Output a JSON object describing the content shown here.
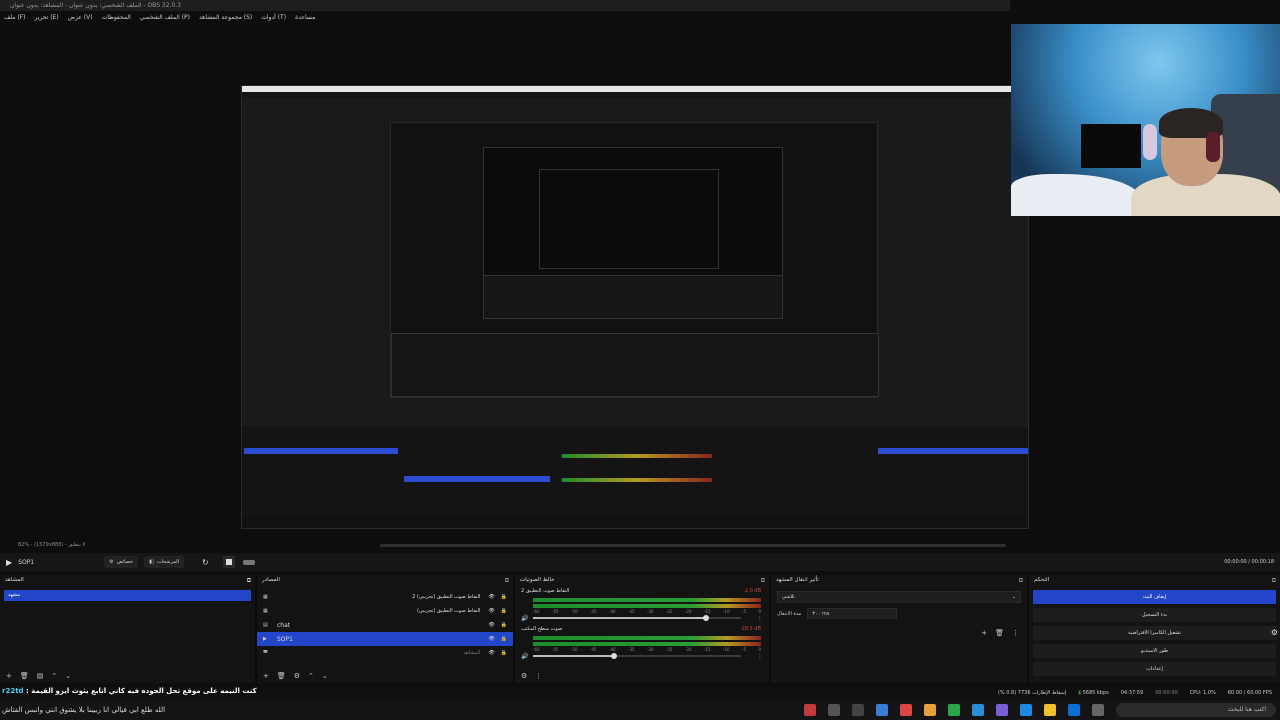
{
  "window": {
    "title": "الملف الشخصي: بدون عنوان - المشاهد: بدون عنوان - OBS 32.0.3"
  },
  "menu": [
    "ملف (F)",
    "تحرير (E)",
    "عرض (V)",
    "المحفوظات",
    "الملف الشخصي (P)",
    "مجموعة المشاهد (S)",
    "أدوات (T)",
    "مساعدة"
  ],
  "zoom": {
    "text": "82% - (1579x888) - لا ينطبق"
  },
  "controls": {
    "scene_name": "SOP1",
    "btn_properties": "خصائص",
    "btn_filters": "المرشحات",
    "time_text": "00:00:00 / 00:00:18"
  },
  "scenes_dock": {
    "title": "المشاهد",
    "items": [
      "مشهد"
    ]
  },
  "sources_dock": {
    "title": "المصادر",
    "items": [
      {
        "label": "التقاط صوت التطبيق (تجريبي) 2",
        "type": "audio"
      },
      {
        "label": "التقاط صوت التطبيق (تجريبي)",
        "type": "audio"
      },
      {
        "label": "chat",
        "type": "text"
      },
      {
        "label": "SOP1",
        "type": "media"
      },
      {
        "label": "المشاهد",
        "type": "scene"
      }
    ]
  },
  "mixer_dock": {
    "title": "خالط الصوتيات",
    "channels": [
      {
        "name": "التقاط صوت التطبيق 2",
        "db": "-2.0 dB",
        "fader": 0.83
      },
      {
        "name": "صوت سطح المكتب",
        "db": "-28.5 dB",
        "fader": 0.39
      }
    ],
    "scale": [
      "-60",
      "-55",
      "-50",
      "-45",
      "-40",
      "-35",
      "-30",
      "-25",
      "-20",
      "-15",
      "-10",
      "-5",
      "0"
    ]
  },
  "transitions_dock": {
    "title": "تأثير انتقال المشهد",
    "selected": "تلاشي",
    "duration_label": "مدة الانتقال",
    "duration_value": "٣٠٠ ms"
  },
  "controls_dock": {
    "title": "التحكم",
    "buttons": [
      "إيقاف البث",
      "بدء التسجيل",
      "تشغيل الكاميرا الافتراضية",
      "طور الاستديو",
      "إعدادات"
    ],
    "active_index": 0
  },
  "status": {
    "dropped": "إسقاط الإطارات 7736 (0.8 %)",
    "bitrate": "5685 kbps",
    "live_time": "04:37:59",
    "rec_time": "00:00:00",
    "cpu": "CPU: 1.0%",
    "fps": "60.00 / 60.00 FPS"
  },
  "chat": {
    "user": "r22td",
    "message": "كنت النيمه على موقع تحل الجوده فيه كاني اتابع بثوث ايزو القيمة",
    "line2": "الله طلع ابي فيالي انا ربيبنا بلا يشوق انني وانبس الفتاش"
  },
  "taskbar": {
    "search_placeholder": "اكتب هنا للبحث"
  },
  "colors": {
    "accent": "#2346c9",
    "meter_green": "#2b9d36",
    "meter_yellow": "#b59a22",
    "meter_red": "#8c2222"
  }
}
